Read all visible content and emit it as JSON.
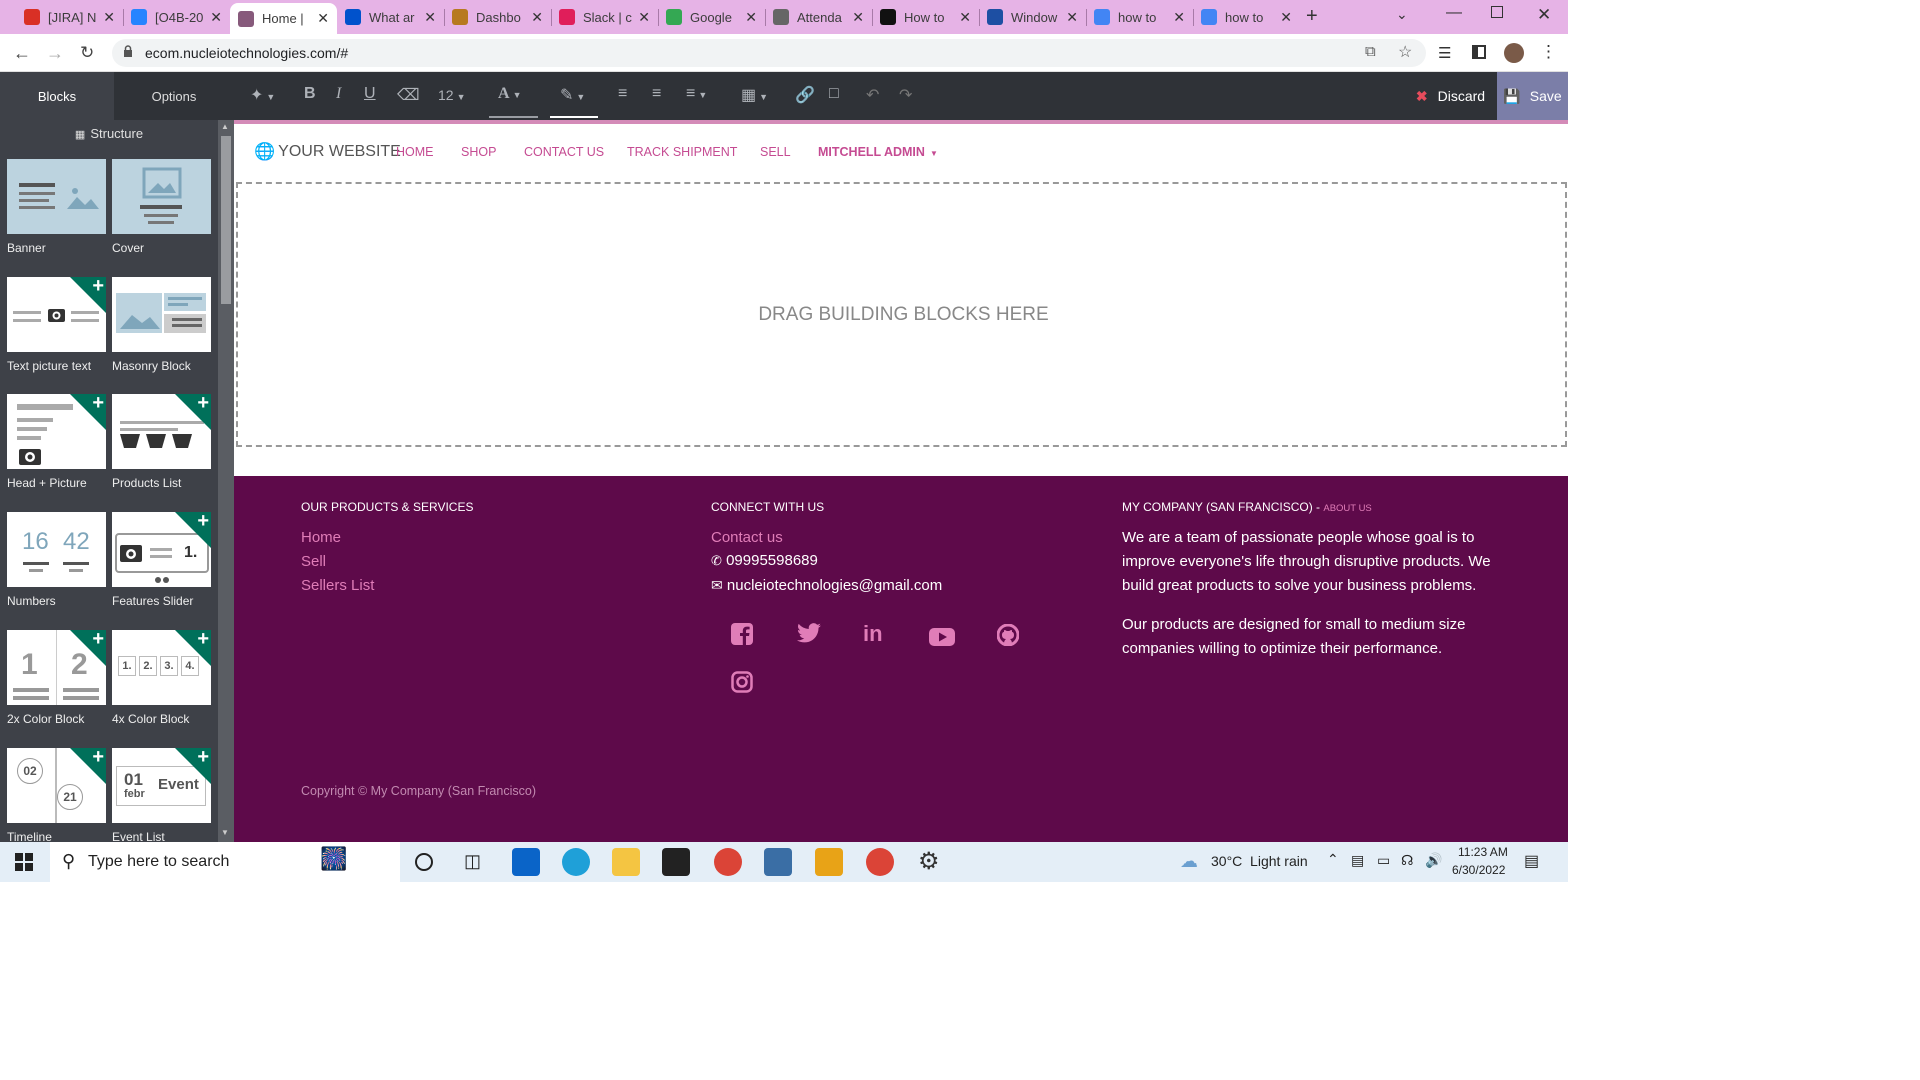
{
  "browser": {
    "tabs": [
      {
        "title": "[JIRA] N",
        "icon": "gmail-icon",
        "color": "#d93025"
      },
      {
        "title": "[O4B-20",
        "icon": "jira-icon",
        "color": "#2684ff"
      },
      {
        "title": "Home |",
        "icon": "odoo-icon",
        "color": "#875a7b",
        "active": true
      },
      {
        "title": "What ar",
        "icon": "atlassian-icon",
        "color": "#0052cc"
      },
      {
        "title": "Dashbo",
        "icon": "dashboard-icon",
        "color": "#b7791f"
      },
      {
        "title": "Slack | c",
        "icon": "slack-icon",
        "color": "#e01e5a"
      },
      {
        "title": "Google",
        "icon": "google-icon",
        "color": "#34a853"
      },
      {
        "title": "Attenda",
        "icon": "globe-icon",
        "color": "#666666"
      },
      {
        "title": "How to",
        "icon": "b-icon",
        "color": "#111111"
      },
      {
        "title": "Window",
        "icon": "vmware-icon",
        "color": "#1d4fa3"
      },
      {
        "title": "how to",
        "icon": "google-icon",
        "color": "#4285f4"
      },
      {
        "title": "how to",
        "icon": "google-icon",
        "color": "#4285f4"
      }
    ],
    "url": "ecom.nucleiotechnologies.com/#"
  },
  "editor": {
    "tabs": {
      "blocks": "Blocks",
      "options": "Options"
    },
    "font_size": "12",
    "discard_label": "Discard",
    "save_label": "Save"
  },
  "sidebar": {
    "structure_label": "Structure",
    "snippets": [
      {
        "label": "Banner"
      },
      {
        "label": "Cover"
      },
      {
        "label": "Text picture text"
      },
      {
        "label": "Masonry Block"
      },
      {
        "label": "Head + Picture"
      },
      {
        "label": "Products List"
      },
      {
        "label": "Numbers"
      },
      {
        "label": "Features Slider"
      },
      {
        "label": "2x Color Block"
      },
      {
        "label": "4x Color Block"
      },
      {
        "label": "Timeline"
      },
      {
        "label": "Event List"
      }
    ],
    "numbers_thumb": [
      "16",
      "42"
    ],
    "color2_thumb": [
      "1",
      "2"
    ],
    "color4_thumb": [
      "1.",
      "2.",
      "3.",
      "4."
    ],
    "timeline_thumb": [
      "02",
      "21"
    ],
    "event_thumb": {
      "day": "01",
      "month": "febr",
      "word": "Event"
    }
  },
  "site": {
    "logo": "YOUR WEBSITE",
    "nav": [
      "HOME",
      "SHOP",
      "CONTACT US",
      "TRACK SHIPMENT",
      "SELL",
      "MITCHELL ADMIN"
    ],
    "drop_text": "DRAG BUILDING BLOCKS HERE",
    "footer": {
      "col1_heading": "OUR PRODUCTS & SERVICES",
      "col1_links": [
        "Home",
        "Sell",
        "Sellers List"
      ],
      "col2_heading": "CONNECT WITH US",
      "contact_link": "Contact us",
      "phone": "09995598689",
      "email": "nucleiotechnologies@gmail.com",
      "col3_heading": "MY COMPANY (SAN FRANCISCO) -",
      "about_link": "ABOUT US",
      "para1": "We are a team of passionate people whose goal is to improve everyone's life through disruptive products. We build great products to solve your business problems.",
      "para2": "Our products are designed for small to medium size companies willing to optimize their performance.",
      "copyright": "Copyright © My Company (San Francisco)"
    }
  },
  "taskbar": {
    "search_placeholder": "Type here to search",
    "weather": "30°C  Light rain",
    "time": "11:23 AM",
    "date": "6/30/2022"
  }
}
